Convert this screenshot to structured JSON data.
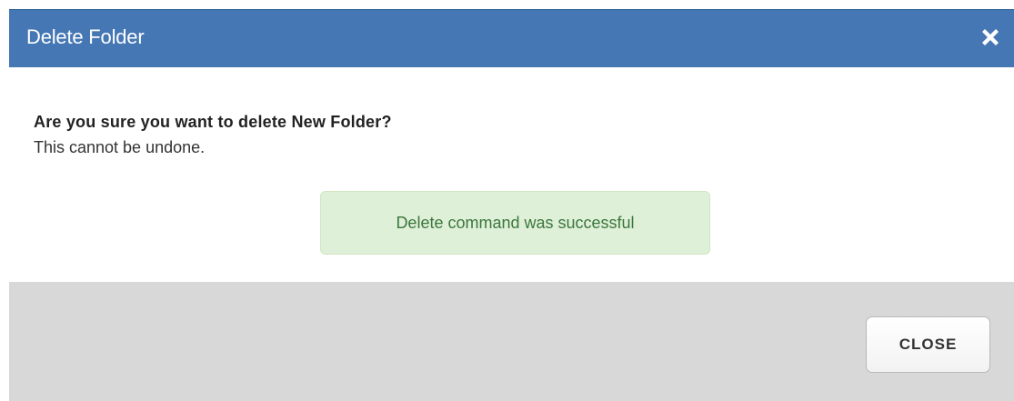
{
  "dialog": {
    "title": "Delete Folder",
    "close_icon": "close-icon",
    "question": "Are you sure you want to delete New Folder?",
    "subtext": "This cannot be undone.",
    "alert": {
      "text": "Delete command was successful",
      "colors": {
        "background": "#dff0d8",
        "text": "#3c763d"
      }
    },
    "footer": {
      "close_button_label": "CLOSE"
    },
    "colors": {
      "titlebar": "#4577b5",
      "footer": "#d8d8d8"
    }
  }
}
